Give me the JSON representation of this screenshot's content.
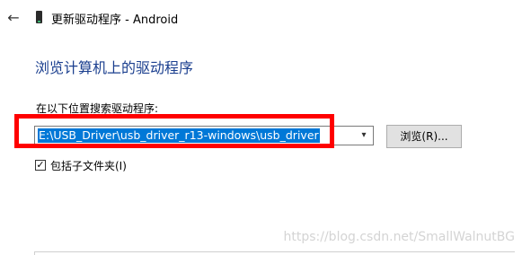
{
  "header": {
    "back_icon": "←",
    "title": "更新驱动程序 - Android"
  },
  "heading": "浏览计算机上的驱动程序",
  "search": {
    "label": "在以下位置搜索驱动程序:",
    "path_value": "E:\\USB_Driver\\usb_driver_r13-windows\\usb_driver",
    "dropdown_icon": "▾",
    "browse_label": "浏览(R)..."
  },
  "include_subfolders": {
    "checked_mark": "✓",
    "label": "包括子文件夹(I)"
  },
  "watermark": "https://blog.csdn.net/SmallWalnutBG",
  "colors": {
    "accent": "#0078d7",
    "highlight_box": "#ff0000",
    "heading": "#1b3f8f"
  }
}
